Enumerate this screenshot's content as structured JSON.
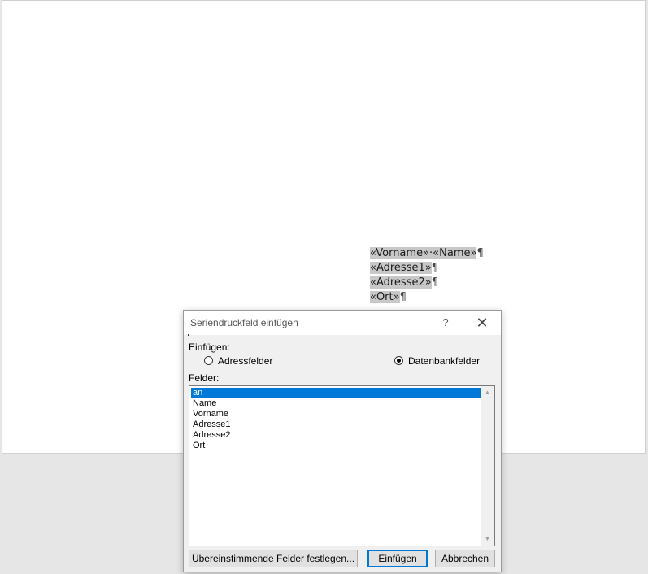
{
  "document": {
    "merge_fields": {
      "vorname": "«Vorname»",
      "name": "«Name»",
      "adresse1": "«Adresse1»",
      "adresse2": "«Adresse2»",
      "ort": "«Ort»"
    },
    "pilcrow": "¶",
    "space_mark": "·"
  },
  "dialog": {
    "title": "Seriendruckfeld einfügen",
    "help_glyph": "?",
    "close_glyph": "✕",
    "insert_label": "Einfügen:",
    "radio_address": "Adressfelder",
    "radio_database": "Datenbankfelder",
    "radio_selected": "Datenbankfelder",
    "fields_label": "Felder:",
    "fields": [
      "an",
      "Name",
      "Vorname",
      "Adresse1",
      "Adresse2",
      "Ort"
    ],
    "selected_field": "an",
    "scroll_up_glyph": "▲",
    "scroll_down_glyph": "▼",
    "btn_match": "Übereinstimmende Felder festlegen...",
    "btn_insert": "Einfügen",
    "btn_cancel": "Abbrechen"
  },
  "colors": {
    "selection": "#0078d7",
    "field_shading": "#c8c8c8"
  }
}
